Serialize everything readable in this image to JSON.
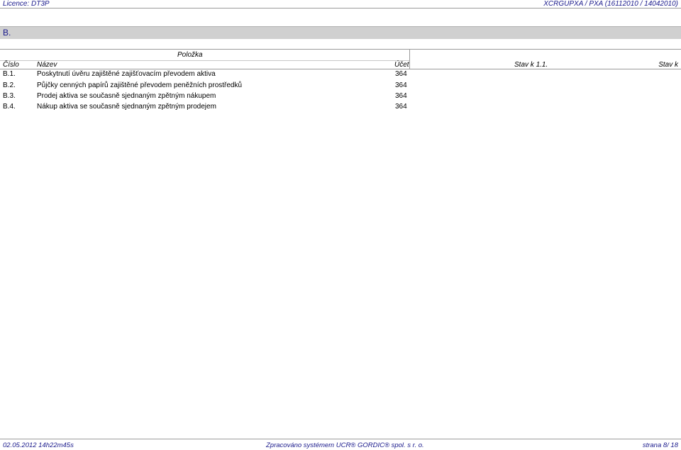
{
  "header": {
    "license": "Licence: DT3P",
    "report_code": "XCRGUPXA / PXA   (16112010 / 14042010)"
  },
  "section": {
    "title": "B."
  },
  "columns": {
    "group": "Položka",
    "number": "Číslo",
    "name": "Název",
    "account": "Účet",
    "state_start": "Stav k 1.1.",
    "state_end": "Stav k"
  },
  "rows": [
    {
      "number": "B.1.",
      "name": "Poskytnutí úvěru zajištěné zajišťovacím převodem aktiva",
      "account": "364"
    },
    {
      "number": "B.2.",
      "name": "Půjčky cenných papírů zajištěné převodem peněžních prostředků",
      "account": "364"
    },
    {
      "number": "B.3.",
      "name": "Prodej aktiva se současně sjednaným zpětným nákupem",
      "account": "364"
    },
    {
      "number": "B.4.",
      "name": "Nákup aktiva se současně sjednaným zpětným prodejem",
      "account": "364"
    }
  ],
  "footer": {
    "timestamp": "02.05.2012 14h22m45s",
    "processed_by": "Zpracováno systémem   UCR® GORDIC® spol. s   r. o.",
    "page": "strana  8/ 18"
  }
}
